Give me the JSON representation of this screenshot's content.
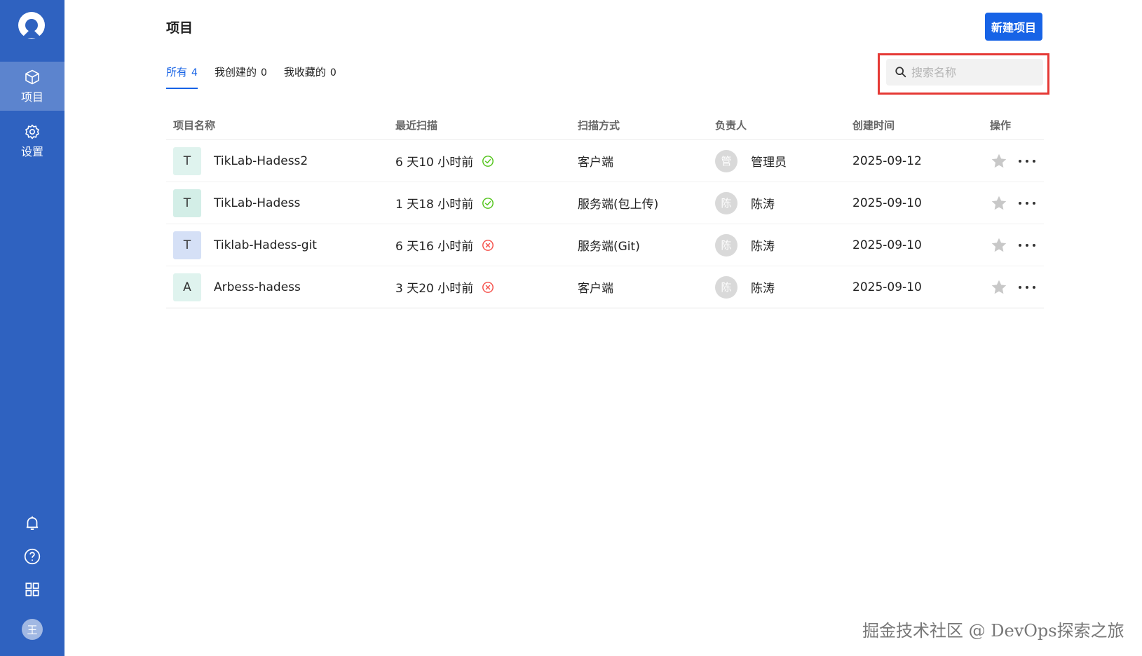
{
  "sidebar": {
    "nav": [
      {
        "label": "项目",
        "icon": "cube-icon",
        "active": true
      },
      {
        "label": "设置",
        "icon": "gear-icon",
        "active": false
      }
    ],
    "bottom_icons": [
      "bell-icon",
      "help-icon",
      "grid-icon"
    ],
    "user_avatar": "王"
  },
  "header": {
    "title": "项目",
    "new_button": "新建项目"
  },
  "tabs": [
    {
      "label": "所有",
      "count": "4",
      "active": true
    },
    {
      "label": "我创建的",
      "count": "0",
      "active": false
    },
    {
      "label": "我收藏的",
      "count": "0",
      "active": false
    }
  ],
  "search": {
    "placeholder": "搜索名称",
    "value": ""
  },
  "table": {
    "columns": [
      "项目名称",
      "最近扫描",
      "扫描方式",
      "负责人",
      "创建时间",
      "操作"
    ],
    "rows": [
      {
        "icon_letter": "T",
        "icon_color": "#dff3ee",
        "name": "TikLab-Hadess2",
        "last_scan": "6 天10 小时前",
        "status": "success",
        "method": "客户端",
        "owner_avatar": "管",
        "owner": "管理员",
        "created": "2025-09-12"
      },
      {
        "icon_letter": "T",
        "icon_color": "#d3eee7",
        "name": "TikLab-Hadess",
        "last_scan": "1 天18 小时前",
        "status": "success",
        "method": "服务端(包上传)",
        "owner_avatar": "陈",
        "owner": "陈涛",
        "created": "2025-09-10"
      },
      {
        "icon_letter": "T",
        "icon_color": "#d5e0f6",
        "name": "Tiklab-Hadess-git",
        "last_scan": "6 天16 小时前",
        "status": "failed",
        "method": "服务端(Git)",
        "owner_avatar": "陈",
        "owner": "陈涛",
        "created": "2025-09-10"
      },
      {
        "icon_letter": "A",
        "icon_color": "#dff3ee",
        "name": "Arbess-hadess",
        "last_scan": "3 天20 小时前",
        "status": "failed",
        "method": "客户端",
        "owner_avatar": "陈",
        "owner": "陈涛",
        "created": "2025-09-10"
      }
    ]
  },
  "colors": {
    "sidebar": "#2f62c0",
    "accent": "#1763e6",
    "success": "#52c41a",
    "error": "#f5504a",
    "highlight": "#e53935"
  },
  "watermark": "掘金技术社区 @ DevOps探索之旅"
}
